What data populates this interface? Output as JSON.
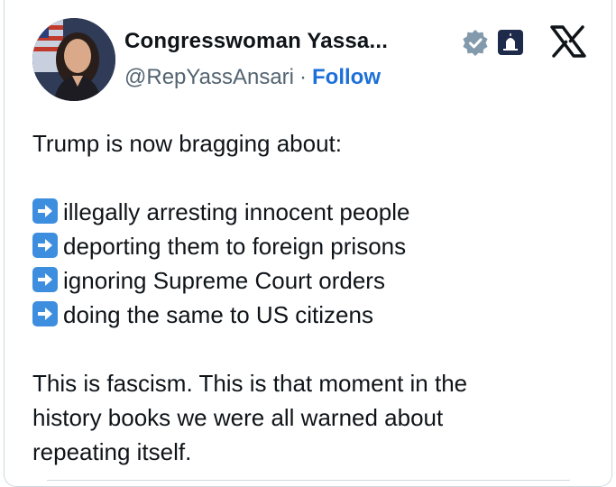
{
  "author": {
    "display_name": "Congresswoman Yassa...",
    "handle": "@RepYassAnsari",
    "separator": "·",
    "follow_label": "Follow"
  },
  "post": {
    "intro": "Trump is now bragging about:",
    "bullets": [
      "illegally arresting innocent people",
      "deporting them to foreign prisons",
      "ignoring Supreme Court orders",
      "doing the same to US citizens"
    ],
    "closing_line1": "This is fascism. This is that moment in the",
    "closing_line2": "history books we were all warned about",
    "closing_line3": "repeating itself."
  },
  "colors": {
    "follow": "#1d6fd9",
    "handle": "#536471",
    "arrow_emoji": "#3e8ee0"
  }
}
